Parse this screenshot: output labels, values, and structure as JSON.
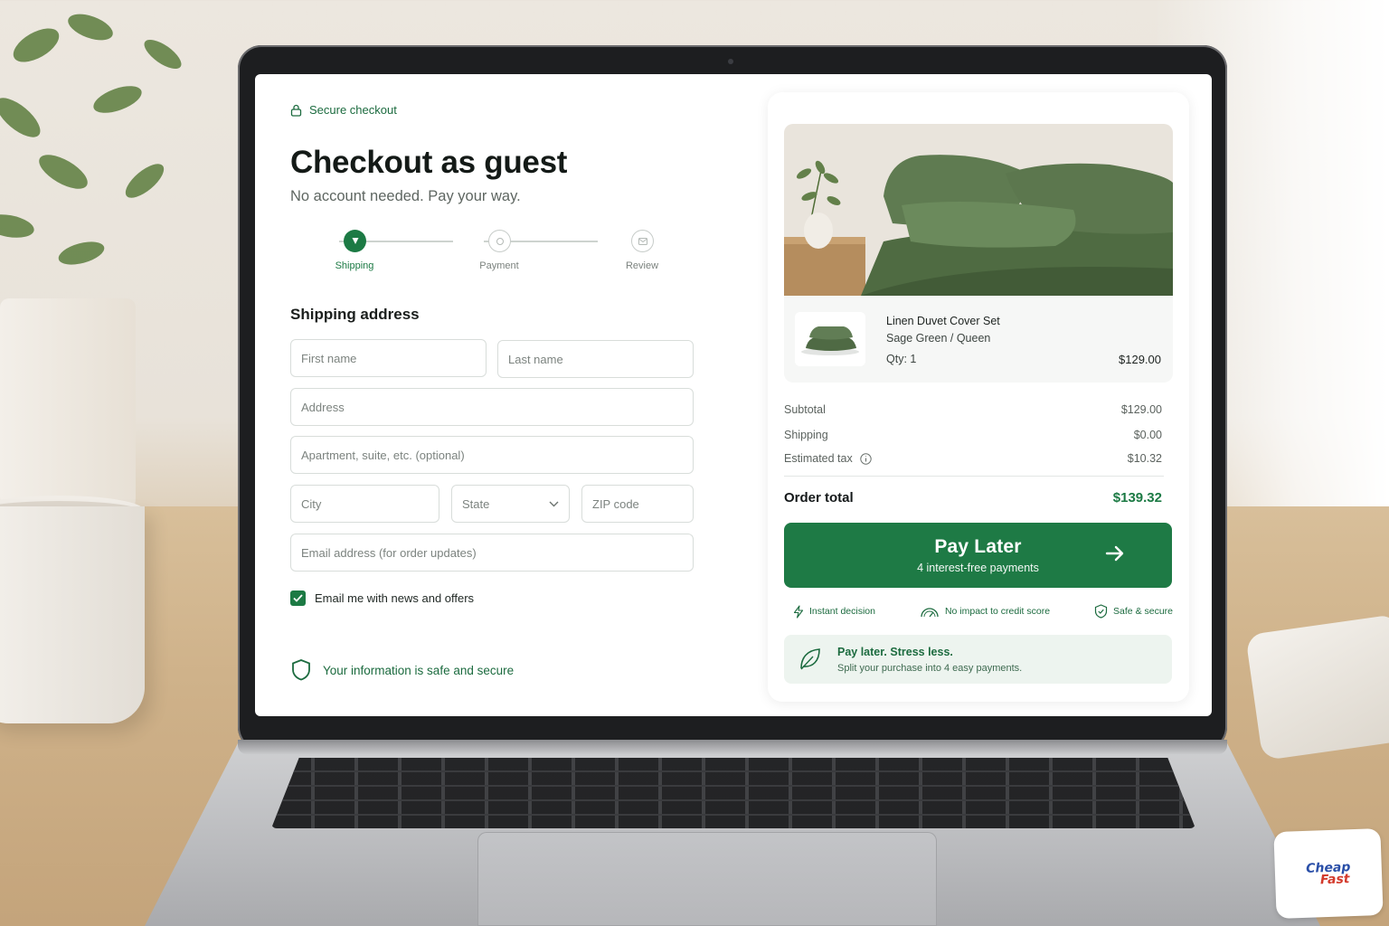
{
  "header": {
    "secure_label": "Secure checkout",
    "title": "Checkout as guest",
    "subtitle": "No account needed. Pay your way."
  },
  "steps": [
    {
      "label": "Shipping",
      "state": "active"
    },
    {
      "label": "Payment",
      "state": "idle"
    },
    {
      "label": "Review",
      "state": "idle"
    }
  ],
  "form": {
    "section_title": "Shipping address",
    "first_name_placeholder": "First name",
    "last_name_placeholder": "Last name",
    "address_placeholder": "Address",
    "apartment_placeholder": "Apartment, suite, etc. (optional)",
    "city_placeholder": "City",
    "state_placeholder": "State",
    "zip_placeholder": "ZIP code",
    "email_placeholder": "Email address (for order updates)",
    "newsletter_label": "Email me with news and offers",
    "newsletter_checked": true,
    "safe_note": "Your information is safe and secure"
  },
  "order": {
    "item_name": "Linen Duvet Cover Set",
    "item_variant": "Sage Green / Queen",
    "item_qty": "Qty: 1",
    "item_price": "$129.00",
    "subtotal_label": "Subtotal",
    "subtotal_value": "$129.00",
    "shipping_label": "Shipping",
    "shipping_value": "$0.00",
    "tax_label": "Estimated tax",
    "tax_value": "$10.32",
    "total_label": "Order total",
    "total_value": "$139.32"
  },
  "pay_button": {
    "label": "Pay Later",
    "sublabel": "4 interest-free payments"
  },
  "trust": [
    {
      "icon": "lightning-icon",
      "label": "Instant decision"
    },
    {
      "icon": "gauge-icon",
      "label": "No impact to credit score"
    },
    {
      "icon": "shield-check-icon",
      "label": "Safe & secure"
    }
  ],
  "promo": {
    "title": "Pay later. Stress less.",
    "subtitle": "Split your purchase into 4 easy payments."
  },
  "watermark": {
    "line1": "Cheap",
    "line2": "Fast"
  },
  "colors": {
    "brand_green": "#1e7a45",
    "promo_bg": "#edf4ef",
    "text_dark": "#141a17"
  }
}
